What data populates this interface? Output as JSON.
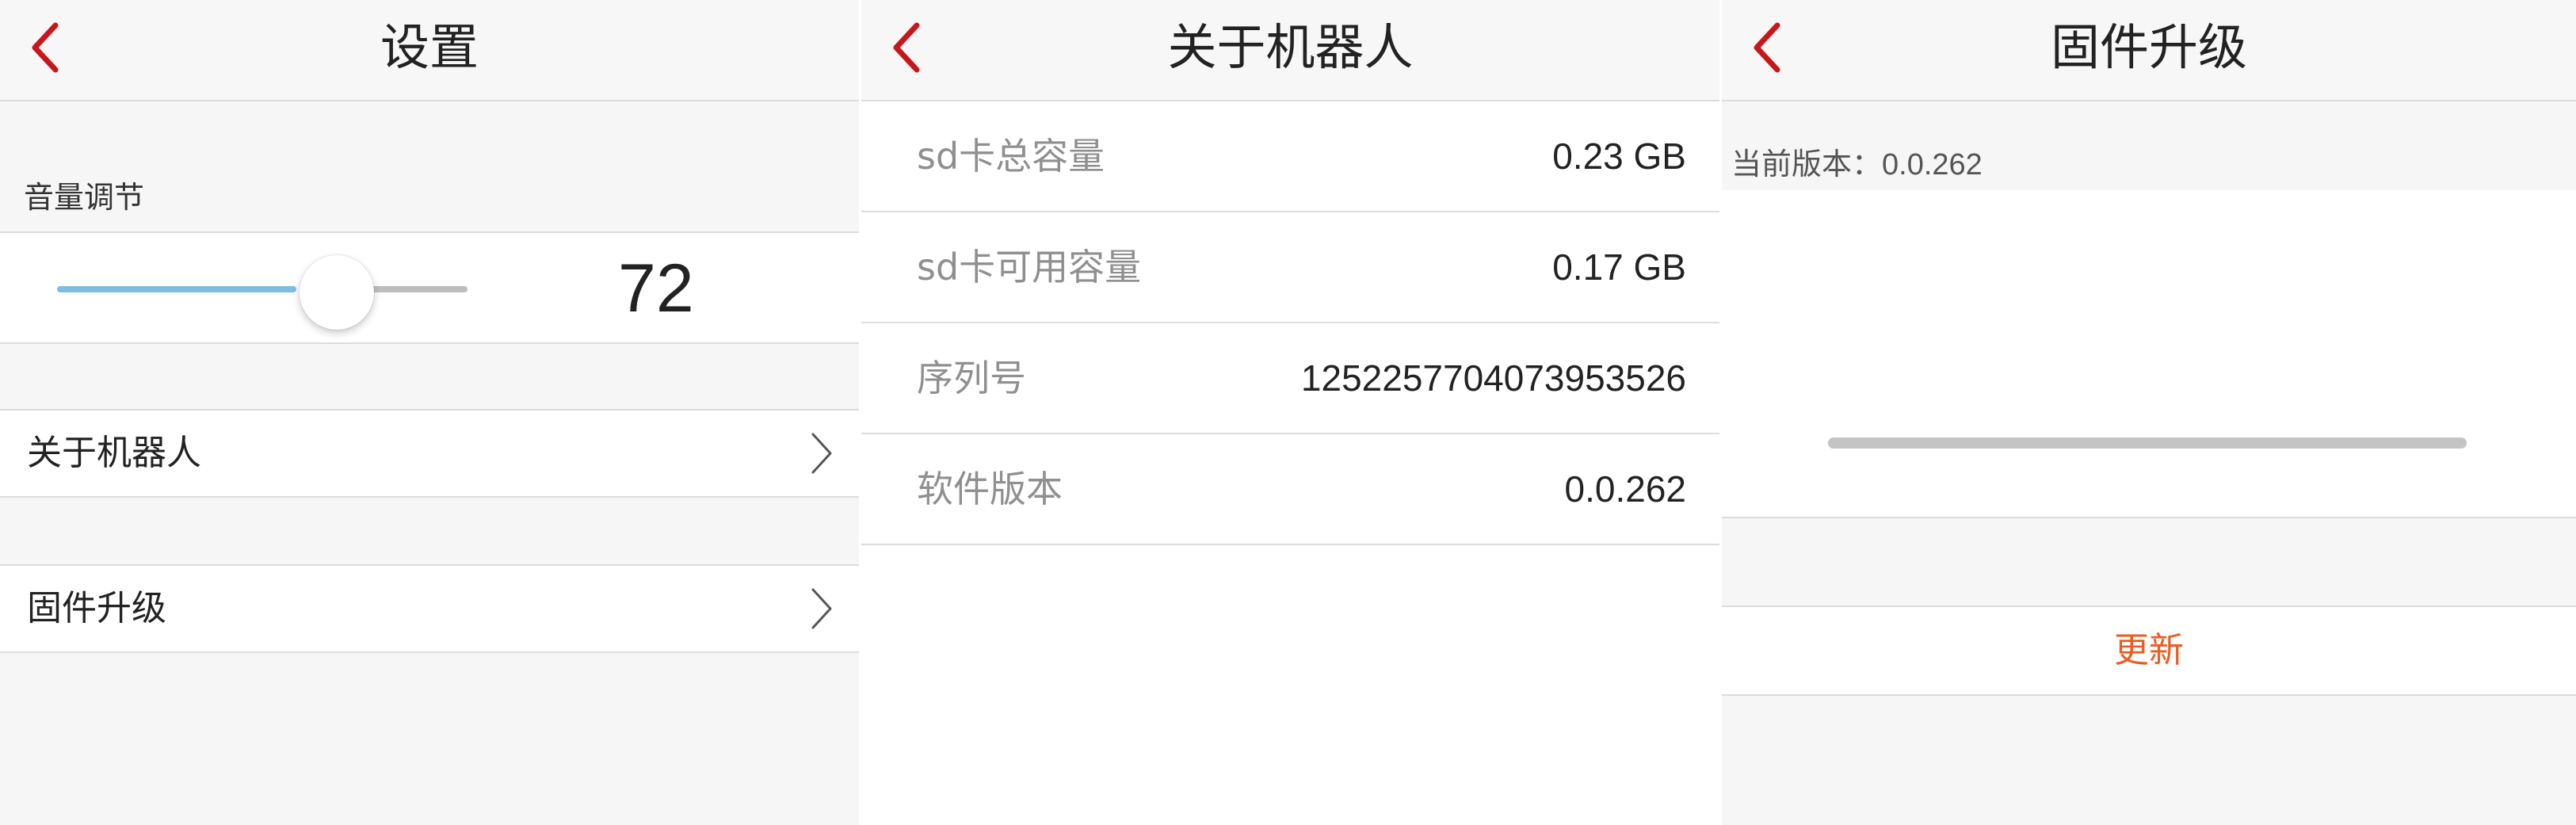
{
  "colors": {
    "accent_red": "#c8161d",
    "update_orange": "#ec5b22",
    "slider_active": "#7fbde0"
  },
  "icons": {
    "back": "back-arrow-icon",
    "chevron": "chevron-right-icon"
  },
  "settings": {
    "title": "设置",
    "volume_label": "音量调节",
    "volume_value": "72",
    "volume_fraction": 0.58,
    "menu": [
      {
        "label": "关于机器人"
      },
      {
        "label": "固件升级"
      }
    ]
  },
  "about": {
    "title": "关于机器人",
    "rows": [
      {
        "label": "sd卡总容量",
        "value": "0.23 GB"
      },
      {
        "label": "sd卡可用容量",
        "value": "0.17 GB"
      },
      {
        "label": "序列号",
        "value": "1252257704073953526"
      },
      {
        "label": "软件版本",
        "value": "0.0.262"
      }
    ]
  },
  "firmware": {
    "title": "固件升级",
    "current_version_label": "当前版本：",
    "current_version": "0.0.262",
    "progress": 0,
    "update_label": "更新"
  }
}
